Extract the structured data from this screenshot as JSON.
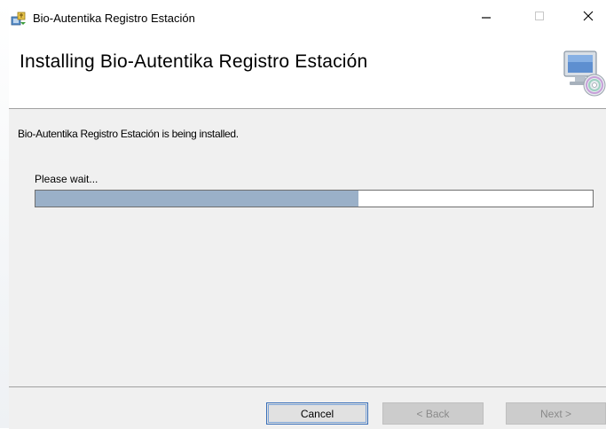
{
  "window": {
    "title": "Bio-Autentika Registro Estación",
    "app_icon": "installer-icon",
    "controls": {
      "minimize_icon": "minimize-icon",
      "maximize_icon": "maximize-icon",
      "close_icon": "close-icon"
    }
  },
  "header": {
    "title": "Installing Bio-Autentika Registro Estación",
    "graphic": "computer-cd-icon"
  },
  "content": {
    "status_text": "Bio-Autentika Registro Estación is being installed.",
    "wait_text": "Please wait...",
    "progress_fraction": 0.58,
    "progress_color": "#9ab0c8"
  },
  "footer": {
    "cancel_label": "Cancel",
    "back_label": "< Back",
    "next_label": "Next >"
  }
}
